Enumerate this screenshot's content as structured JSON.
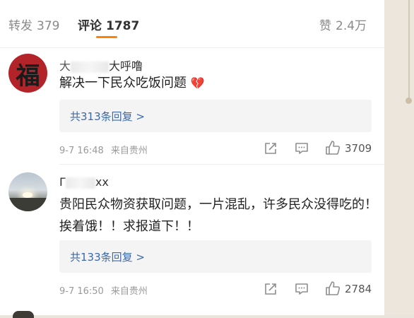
{
  "tabs": [
    {
      "label": "转发",
      "count": "379"
    },
    {
      "label": "评论",
      "count": "1787"
    },
    {
      "label": "赞",
      "count": "2.4万"
    }
  ],
  "colors": {
    "accent": "#ff8200",
    "link": "#3c68a8",
    "heart": "#d4374b"
  },
  "comments": [
    {
      "username_visible_start": "大",
      "username_visible_end": "大呼噜",
      "avatar_icon": "fu-character-icon",
      "avatar_char": "福",
      "text": "解决一下民众吃饭问题",
      "emoji": "broken-heart-icon",
      "emoji_glyph": "💔",
      "reply_link": "共313条回复 >",
      "time": "9-7 16:48",
      "location": "来自贵州",
      "likes": "3709"
    },
    {
      "username_visible_start": "Γ",
      "username_visible_end": "xx",
      "avatar_icon": "sunset-icon",
      "text": "贵阳民众物资获取问题，一片混乱，许多民众没得吃的！挨着饿！！求报道下！！",
      "reply_link": "共133条回复 >",
      "time": "9-7 16:50",
      "location": "来自贵州",
      "likes": "2784"
    }
  ]
}
